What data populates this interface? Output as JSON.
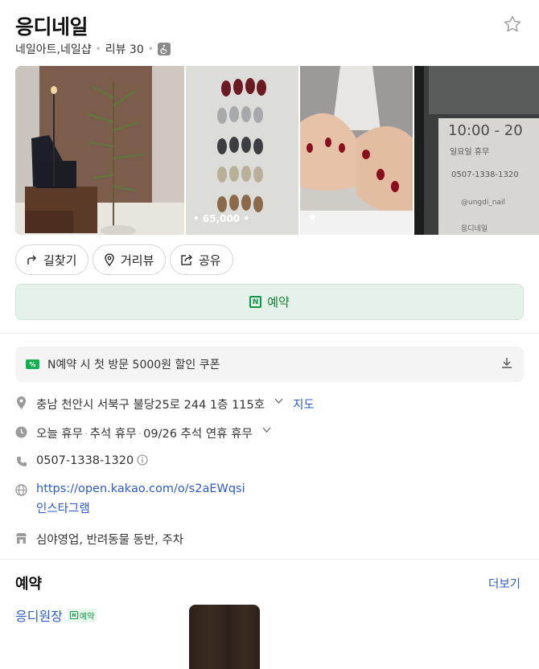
{
  "place": {
    "name": "응디네일",
    "category": "네일아트,네일샵",
    "review_label": "리뷰 30"
  },
  "photos": {
    "p2_caption": "• 65,000 •",
    "p4_hours": "10:00 - 20",
    "p4_sub": "일요일 휴무",
    "p4_phone": "0507-1338-1320",
    "p4_insta": "@ungdi_nail",
    "p4_name": "응디네일"
  },
  "actions": {
    "directions": "길찾기",
    "streetview": "거리뷰",
    "share": "공유",
    "reserve": "예약"
  },
  "coupon": {
    "text": "N예약 시 첫 방문 5000원 할인 쿠폰"
  },
  "info": {
    "address": "충남 천안시 서북구 불당25로 244 1층 115호",
    "map_link": "지도",
    "hours_1": "오늘 휴무",
    "hours_2": "추석 휴무",
    "hours_3": "09/26 추석 연휴 휴무",
    "phone": "0507-1338-1320",
    "website": "https://open.kakao.com/o/s2aEWqsi",
    "instagram": "인스타그램",
    "amenities": "심야영업, 반려동물 동반, 주차"
  },
  "booking": {
    "title": "예약",
    "more": "더보기",
    "staff_name": "응디원장",
    "staff_badge": "예약"
  },
  "colors": {
    "accent_green": "#0e9a45",
    "link_blue": "#2c5bc9",
    "reserve_bg": "#e4f2e9"
  }
}
